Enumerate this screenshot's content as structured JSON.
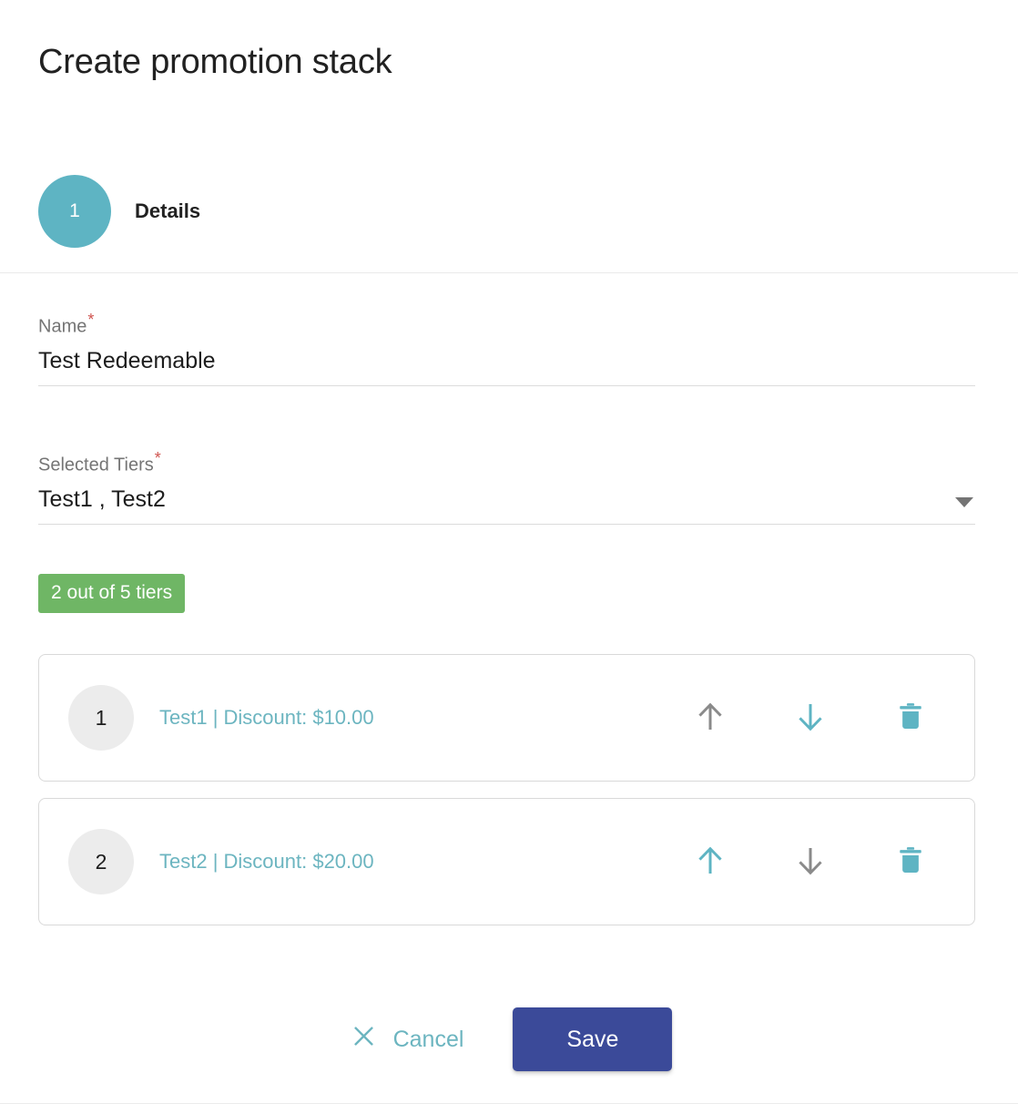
{
  "dialog": {
    "title": "Create promotion stack"
  },
  "stepper": {
    "step_number": "1",
    "step_label": "Details"
  },
  "form": {
    "name": {
      "label": "Name",
      "required_marker": "*",
      "value": "Test Redeemable",
      "placeholder": "Name"
    },
    "selected_tiers": {
      "label": "Selected Tiers",
      "required_marker": "*",
      "value": "Test1 , Test2",
      "placeholder": "Selected Tiers",
      "caret_icon": "chevron-down-icon"
    }
  },
  "badge": {
    "text": "2 out of 5 tiers",
    "selected_count": 2,
    "total_count": 5,
    "color": "#6fb665"
  },
  "tiers": [
    {
      "index": "1",
      "text": "Test1 | Discount: $10.00",
      "name": "Test1",
      "discount": "$10.00",
      "move_up_enabled": false,
      "move_down_enabled": true,
      "up_icon": "arrow-up-icon",
      "down_icon": "arrow-down-icon",
      "delete_icon": "trash-icon"
    },
    {
      "index": "2",
      "text": "Test2 | Discount: $20.00",
      "name": "Test2",
      "discount": "$20.00",
      "move_up_enabled": true,
      "move_down_enabled": false,
      "up_icon": "arrow-up-icon",
      "down_icon": "arrow-down-icon",
      "delete_icon": "trash-icon"
    }
  ],
  "footer": {
    "cancel_label": "Cancel",
    "cancel_icon": "close-x-icon",
    "save_label": "Save"
  },
  "colors": {
    "accent_teal": "#5eb4c3",
    "link_teal": "#6cb5c0",
    "badge_green": "#6fb665",
    "save_indigo": "#3b4a99",
    "required_red": "#d0544f",
    "disabled_gray": "#8a8a8a"
  }
}
